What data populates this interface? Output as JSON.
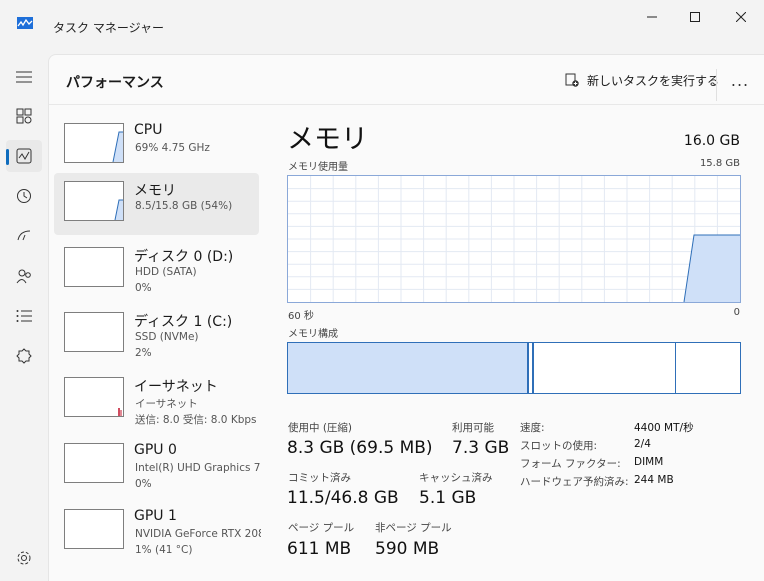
{
  "app": {
    "title": "タスク マネージャー"
  },
  "header": {
    "page_title": "パフォーマンス",
    "run_new_task": "新しいタスクを実行する",
    "more": "..."
  },
  "nav": [
    "menu-icon",
    "processes-icon",
    "performance-icon",
    "app-history-icon",
    "startup-icon",
    "users-icon",
    "details-icon",
    "services-icon",
    "settings-icon"
  ],
  "sidebar": {
    "items": [
      {
        "title": "CPU",
        "line1": "69%  4.75 GHz",
        "line2": ""
      },
      {
        "title": "メモリ",
        "line1": "8.5/15.8 GB (54%)",
        "line2": ""
      },
      {
        "title": "ディスク 0 (D:)",
        "line1": "HDD (SATA)",
        "line2": "0%"
      },
      {
        "title": "ディスク 1 (C:)",
        "line1": "SSD (NVMe)",
        "line2": "2%"
      },
      {
        "title": "イーサネット",
        "line1": "イーサネット",
        "line2": "送信: 8.0 受信: 8.0 Kbps"
      },
      {
        "title": "GPU 0",
        "line1": "Intel(R) UHD Graphics 7",
        "line2": "0%"
      },
      {
        "title": "GPU 1",
        "line1": "NVIDIA GeForce RTX 208",
        "line2": "1% (41 °C)"
      }
    ]
  },
  "detail": {
    "title": "メモリ",
    "total": "16.0 GB",
    "usage_label": "メモリ使用量",
    "usage_max": "15.8 GB",
    "time_left": "60 秒",
    "time_right": "0",
    "composition_label": "メモリ構成",
    "stats": {
      "in_use_label": "使用中 (圧縮)",
      "in_use_value": "8.3 GB (69.5 MB)",
      "available_label": "利用可能",
      "available_value": "7.3 GB",
      "committed_label": "コミット済み",
      "committed_value": "11.5/46.8 GB",
      "cached_label": "キャッシュ済み",
      "cached_value": "5.1 GB",
      "paged_label": "ページ プール",
      "paged_value": "611 MB",
      "nonpaged_label": "非ページ プール",
      "nonpaged_value": "590 MB"
    },
    "specs": {
      "speed_label": "速度:",
      "speed_value": "4400 MT/秒",
      "slots_label": "スロットの使用:",
      "slots_value": "2/4",
      "form_label": "フォーム ファクター:",
      "form_value": "DIMM",
      "reserved_label": "ハードウェア予約済み:",
      "reserved_value": "244 MB"
    }
  },
  "colors": {
    "accent": "#0f6cbd",
    "graph_fill": "#cfe0f8",
    "graph_line": "#2f6fb8",
    "eth_spike": "#c0102a"
  }
}
